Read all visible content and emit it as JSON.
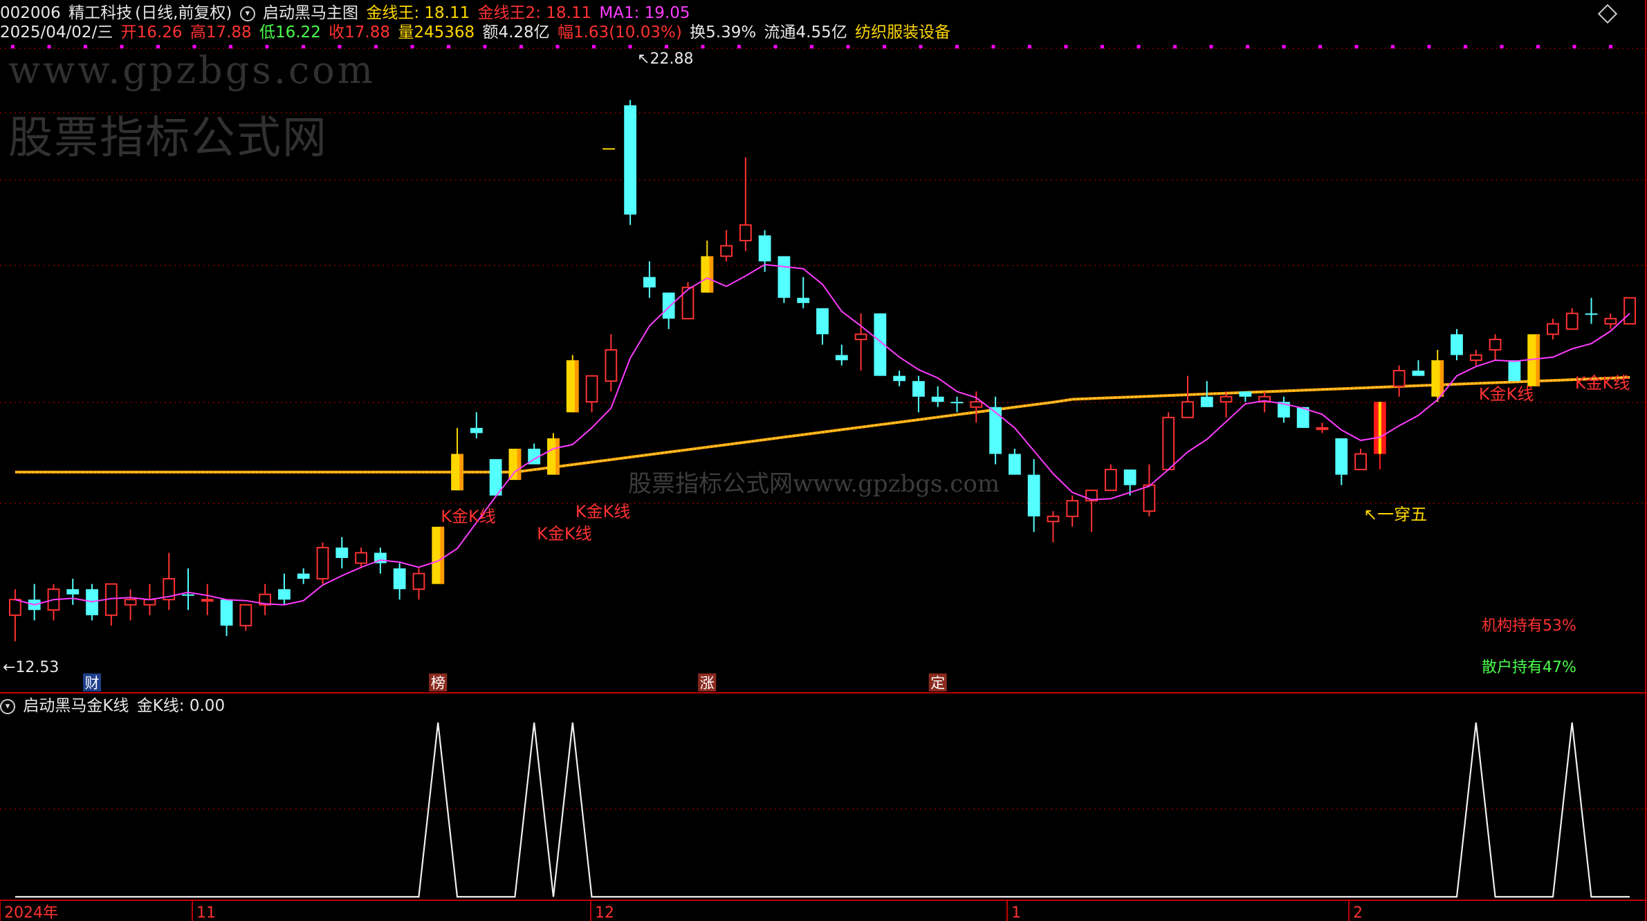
{
  "header": {
    "code": "002006",
    "name": "精工科技",
    "period": "(日线,前复权)",
    "indicator_name": "启动黑马主图",
    "ma_gold": "金线王: 18.11",
    "ma_gold2": "金线王2: 18.11",
    "ma1": "MA1: 19.05"
  },
  "quote": {
    "date": "2025/04/02/三",
    "open": "开16.26",
    "high": "高17.88",
    "low": "低16.22",
    "close": "收17.88",
    "volume": "量245368",
    "amount": "额4.28亿",
    "change": "幅1.63(10.03%)",
    "turnover": "换5.39%",
    "float": "流通4.55亿",
    "sector": "纺织服装设备"
  },
  "watermarks": {
    "url": "www.gpzbgs.com",
    "site": "股票指标公式网",
    "center": "股票指标公式网www.gpzbgs.com"
  },
  "annotations": {
    "high_label": "22.88",
    "low_label": "12.53",
    "golden_k_label": "K金K线",
    "one_five_label": "一穿五",
    "institution": "机构持有53%",
    "retail": "散户持有47%"
  },
  "event_markers": [
    "财",
    "榜",
    "涨",
    "定"
  ],
  "sub_panel": {
    "title": "启动黑马金K线",
    "value_label": "金K线: 0.00"
  },
  "x_axis": {
    "labels": [
      "2024年",
      "11",
      "12",
      "1",
      "2"
    ]
  },
  "colors": {
    "up": "#ff3232",
    "down": "#54ffff",
    "golden": "#ffd700",
    "ma_line": "#ff3cff",
    "long_ma": "#ffa500",
    "grid": "#8b0000"
  },
  "chart_data": {
    "type": "candlestick",
    "y_range": [
      12.0,
      24.0
    ],
    "candles": [
      [
        13.0,
        13.5,
        12.5,
        13.3,
        "u"
      ],
      [
        13.3,
        13.6,
        12.9,
        13.1,
        "d"
      ],
      [
        13.1,
        13.6,
        12.9,
        13.5,
        "u"
      ],
      [
        13.5,
        13.7,
        13.2,
        13.4,
        "d"
      ],
      [
        13.5,
        13.6,
        12.9,
        13.0,
        "d"
      ],
      [
        13.0,
        13.6,
        12.8,
        13.6,
        "u"
      ],
      [
        13.3,
        13.5,
        12.9,
        13.2,
        "u"
      ],
      [
        13.2,
        13.6,
        13.0,
        13.3,
        "u"
      ],
      [
        13.3,
        14.2,
        13.1,
        13.7,
        "u"
      ],
      [
        13.4,
        13.9,
        13.1,
        13.4,
        "d"
      ],
      [
        13.3,
        13.6,
        13.0,
        13.3,
        "u"
      ],
      [
        13.3,
        13.3,
        12.6,
        12.8,
        "d"
      ],
      [
        12.8,
        13.2,
        12.7,
        13.2,
        "u"
      ],
      [
        13.2,
        13.6,
        13.0,
        13.4,
        "u"
      ],
      [
        13.5,
        13.8,
        13.2,
        13.3,
        "d"
      ],
      [
        13.8,
        13.9,
        13.6,
        13.7,
        "d"
      ],
      [
        13.7,
        14.4,
        13.6,
        14.3,
        "u"
      ],
      [
        14.3,
        14.5,
        13.9,
        14.1,
        "d"
      ],
      [
        14.0,
        14.3,
        13.9,
        14.2,
        "u"
      ],
      [
        14.2,
        14.3,
        13.8,
        14.0,
        "d"
      ],
      [
        13.9,
        14.0,
        13.3,
        13.5,
        "d"
      ],
      [
        13.5,
        13.9,
        13.3,
        13.8,
        "u"
      ],
      [
        13.6,
        14.7,
        13.6,
        14.7,
        "g"
      ],
      [
        16.1,
        16.6,
        15.4,
        15.4,
        "g"
      ],
      [
        16.6,
        16.9,
        16.4,
        16.5,
        "d"
      ],
      [
        15.3,
        16.0,
        15.3,
        16.0,
        "d"
      ],
      [
        15.6,
        16.2,
        15.6,
        16.2,
        "g"
      ],
      [
        16.2,
        16.3,
        15.9,
        15.9,
        "d"
      ],
      [
        15.7,
        16.5,
        15.7,
        16.4,
        "g"
      ],
      [
        17.9,
        18.0,
        16.9,
        16.9,
        "g"
      ],
      [
        17.1,
        17.6,
        16.9,
        17.6,
        "u"
      ],
      [
        17.5,
        18.4,
        17.3,
        18.1,
        "u"
      ],
      [
        22.8,
        22.9,
        20.5,
        20.7,
        "d"
      ],
      [
        19.3,
        19.8,
        19.1,
        19.5,
        "d"
      ],
      [
        19.2,
        19.2,
        18.5,
        18.7,
        "d"
      ],
      [
        18.7,
        19.4,
        18.7,
        19.3,
        "u"
      ],
      [
        19.9,
        20.2,
        19.2,
        19.2,
        "g"
      ],
      [
        20.1,
        20.4,
        19.8,
        19.9,
        "u"
      ],
      [
        20.2,
        21.8,
        20.0,
        20.5,
        "u"
      ],
      [
        20.3,
        20.4,
        19.6,
        19.8,
        "d"
      ],
      [
        19.9,
        19.9,
        19.0,
        19.1,
        "d"
      ],
      [
        19.1,
        19.5,
        18.9,
        19.0,
        "d"
      ],
      [
        18.9,
        18.9,
        18.2,
        18.4,
        "d"
      ],
      [
        18.0,
        18.2,
        17.8,
        17.9,
        "d"
      ],
      [
        18.3,
        18.8,
        17.7,
        18.4,
        "u"
      ],
      [
        18.8,
        18.8,
        17.6,
        17.6,
        "d"
      ],
      [
        17.6,
        17.7,
        17.4,
        17.5,
        "d"
      ],
      [
        17.5,
        17.6,
        16.9,
        17.2,
        "d"
      ],
      [
        17.2,
        17.4,
        17.0,
        17.1,
        "d"
      ],
      [
        17.1,
        17.2,
        16.9,
        17.1,
        "d"
      ],
      [
        17.1,
        17.3,
        16.7,
        17.0,
        "u"
      ],
      [
        17.0,
        17.2,
        15.9,
        16.1,
        "d"
      ],
      [
        16.1,
        16.2,
        15.7,
        15.7,
        "d"
      ],
      [
        15.7,
        16.0,
        14.6,
        14.9,
        "d"
      ],
      [
        14.8,
        15.0,
        14.4,
        14.9,
        "u"
      ],
      [
        14.9,
        15.3,
        14.7,
        15.2,
        "u"
      ],
      [
        15.2,
        15.4,
        14.6,
        15.4,
        "u"
      ],
      [
        15.4,
        15.9,
        15.4,
        15.8,
        "u"
      ],
      [
        15.8,
        15.8,
        15.3,
        15.5,
        "d"
      ],
      [
        15.0,
        15.9,
        14.9,
        15.5,
        "u"
      ],
      [
        15.8,
        16.9,
        15.8,
        16.8,
        "u"
      ],
      [
        16.8,
        17.6,
        16.8,
        17.1,
        "u"
      ],
      [
        17.2,
        17.5,
        17.0,
        17.0,
        "d"
      ],
      [
        17.1,
        17.3,
        16.8,
        17.2,
        "u"
      ],
      [
        17.3,
        17.3,
        17.1,
        17.2,
        "d"
      ],
      [
        17.2,
        17.3,
        16.9,
        17.1,
        "u"
      ],
      [
        17.1,
        17.2,
        16.7,
        16.8,
        "d"
      ],
      [
        17.0,
        17.0,
        16.6,
        16.6,
        "d"
      ],
      [
        16.6,
        16.7,
        16.5,
        16.6,
        "u"
      ],
      [
        16.4,
        16.4,
        15.5,
        15.7,
        "d"
      ],
      [
        15.8,
        16.2,
        15.8,
        16.1,
        "u"
      ],
      [
        16.1,
        17.1,
        15.8,
        17.1,
        "r"
      ],
      [
        17.4,
        17.8,
        17.2,
        17.7,
        "u"
      ],
      [
        17.7,
        17.9,
        17.6,
        17.6,
        "d"
      ],
      [
        17.9,
        18.1,
        17.1,
        17.2,
        "g"
      ],
      [
        18.0,
        18.5,
        17.9,
        18.4,
        "d"
      ],
      [
        17.9,
        18.1,
        17.8,
        18.0,
        "u"
      ],
      [
        18.1,
        18.4,
        17.9,
        18.3,
        "u"
      ],
      [
        17.9,
        17.9,
        17.5,
        17.5,
        "d"
      ],
      [
        18.4,
        18.4,
        17.4,
        17.4,
        "g"
      ],
      [
        18.4,
        18.7,
        18.3,
        18.6,
        "u"
      ],
      [
        18.5,
        18.9,
        18.5,
        18.8,
        "u"
      ],
      [
        18.8,
        19.1,
        18.6,
        18.8,
        "d"
      ],
      [
        18.6,
        18.8,
        18.5,
        18.7,
        "u"
      ],
      [
        18.6,
        19.1,
        18.6,
        19.1,
        "u"
      ]
    ],
    "signal_peaks": [
      22,
      27,
      29,
      76,
      81
    ]
  }
}
